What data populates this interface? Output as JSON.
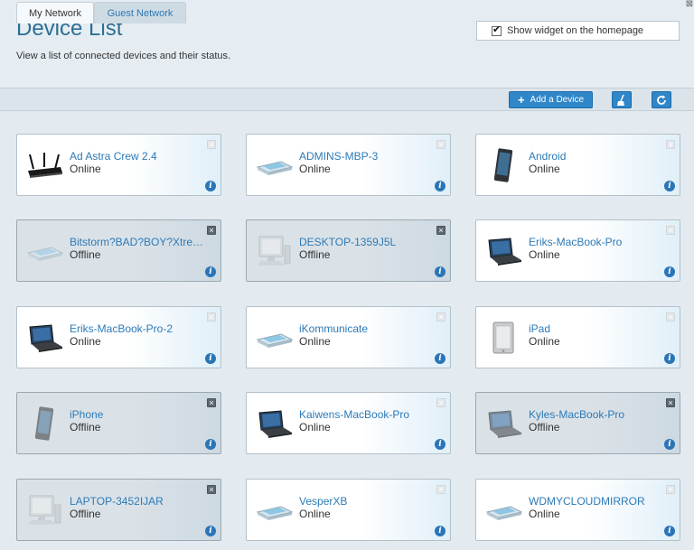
{
  "header": {
    "title": "Device List",
    "subtitle": "View a list of connected devices and their status.",
    "widget_label": "Show widget on the homepage",
    "close_glyph": "⊠"
  },
  "tabs": [
    {
      "label": "My Network",
      "active": true
    },
    {
      "label": "Guest Network",
      "active": false
    }
  ],
  "toolbar": {
    "add_label": "Add a Device",
    "clean_icon": "broom-icon",
    "refresh_icon": "refresh-icon"
  },
  "devices": [
    {
      "name": "Ad Astra Crew 2.4",
      "status": "Online",
      "icon": "router-icon"
    },
    {
      "name": "ADMINS-MBP-3",
      "status": "Online",
      "icon": "laptop-closed-icon"
    },
    {
      "name": "Android",
      "status": "Online",
      "icon": "phone-icon"
    },
    {
      "name": "Bitstorm?BAD?BOY?Xtre…",
      "status": "Offline",
      "icon": "laptop-closed-icon"
    },
    {
      "name": "DESKTOP-1359J5L",
      "status": "Offline",
      "icon": "desktop-icon"
    },
    {
      "name": "Eriks-MacBook-Pro",
      "status": "Online",
      "icon": "laptop-open-icon"
    },
    {
      "name": "Eriks-MacBook-Pro-2",
      "status": "Online",
      "icon": "laptop-open-icon"
    },
    {
      "name": "iKommunicate",
      "status": "Online",
      "icon": "laptop-closed-icon"
    },
    {
      "name": "iPad",
      "status": "Online",
      "icon": "tablet-icon"
    },
    {
      "name": "iPhone",
      "status": "Offline",
      "icon": "phone-icon"
    },
    {
      "name": "Kaiwens-MacBook-Pro",
      "status": "Online",
      "icon": "laptop-open-icon"
    },
    {
      "name": "Kyles-MacBook-Pro",
      "status": "Offline",
      "icon": "laptop-open-icon"
    },
    {
      "name": "LAPTOP-3452IJAR",
      "status": "Offline",
      "icon": "desktop-icon"
    },
    {
      "name": "VesperXB",
      "status": "Online",
      "icon": "laptop-closed-icon"
    },
    {
      "name": "WDMYCLOUDMIRROR",
      "status": "Online",
      "icon": "laptop-closed-icon"
    }
  ],
  "colors": {
    "accent": "#2f86c9",
    "link": "#2c7ab7",
    "title": "#2d6f95",
    "offline_bg": "#dbe2e7"
  }
}
